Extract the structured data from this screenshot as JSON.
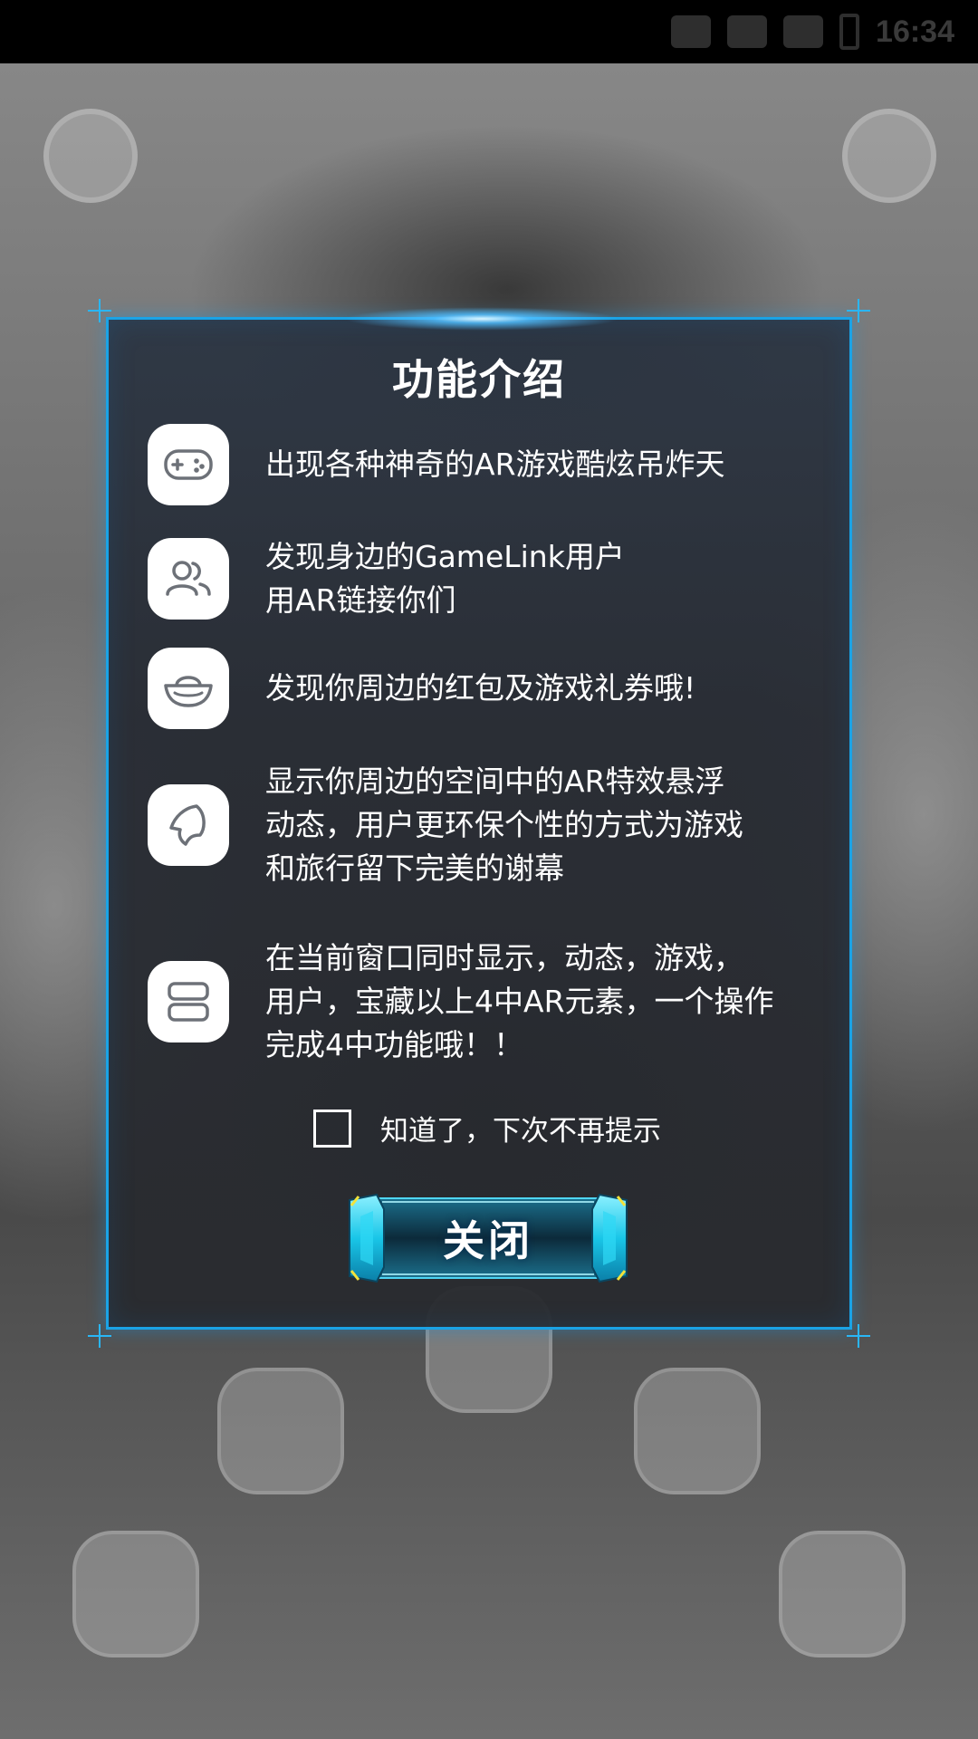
{
  "status_bar": {
    "time": "16:34"
  },
  "dialog": {
    "title": "功能介绍",
    "features": [
      {
        "icon": "gamepad-icon",
        "lines": [
          "出现各种神奇的AR游戏酷炫吊炸天"
        ]
      },
      {
        "icon": "users-icon",
        "lines": [
          "发现身边的GameLink用户",
          "用AR链接你们"
        ]
      },
      {
        "icon": "gold-ingot-icon",
        "lines": [
          "发现你周边的红包及游戏礼券哦!"
        ]
      },
      {
        "icon": "ghost-icon",
        "lines": [
          "显示你周边的空间中的AR特效悬浮",
          "动态，用户更环保个性的方式为游戏",
          "和旅行留下完美的谢幕"
        ]
      },
      {
        "icon": "stack-icon",
        "lines": [
          "在当前窗口同时显示，动态，游戏，",
          "用户，宝藏以上4中AR元素，一个操作",
          "完成4中功能哦！！"
        ]
      }
    ],
    "checkbox_label": "知道了，下次不再提示",
    "checkbox_checked": false,
    "close_label": "关闭"
  },
  "colors": {
    "accent": "#1aa3e6",
    "dialog_bg": "#2a3442",
    "button_cyan": "#19c6e8"
  }
}
